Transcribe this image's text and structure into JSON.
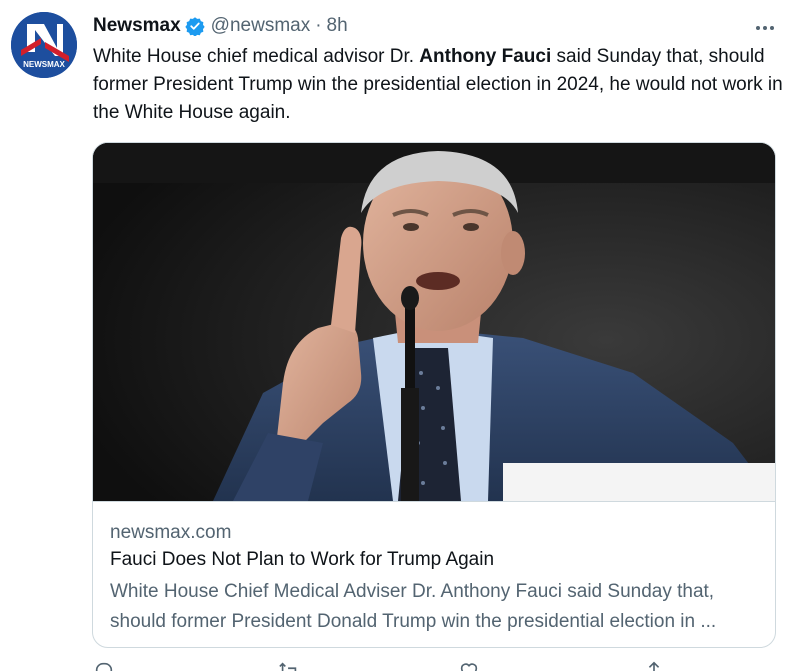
{
  "tweet": {
    "display_name": "Newsmax",
    "handle": "@newsmax",
    "separator": "·",
    "time": "8h",
    "text_before": "White House chief medical advisor Dr. ",
    "text_bold": "Anthony Fauci",
    "text_after": " said Sunday that, should former President Trump win the presidential election in 2024, he would not work in the White House again."
  },
  "avatar": {
    "logo_text": "NEWSMAX",
    "colors": {
      "bg": "#1d4e9e",
      "red": "#d21f2b",
      "white": "#ffffff"
    }
  },
  "card": {
    "domain": "newsmax.com",
    "title": "Fauci Does Not Plan to Work for Trump Again",
    "description_line1": "White House Chief Medical Adviser Dr. Anthony Fauci said Sunday that,",
    "description_line2": "should former President Donald Trump win the presidential election in ..."
  },
  "icons": {
    "verified": "verified-badge-icon",
    "more": "more-options-icon",
    "reply": "reply-icon",
    "retweet": "retweet-icon",
    "like": "like-icon",
    "share": "share-icon"
  },
  "colors": {
    "accent": "#1d9bf0",
    "text_primary": "#0f1419",
    "text_secondary": "#536471",
    "border": "#cfd9de"
  }
}
